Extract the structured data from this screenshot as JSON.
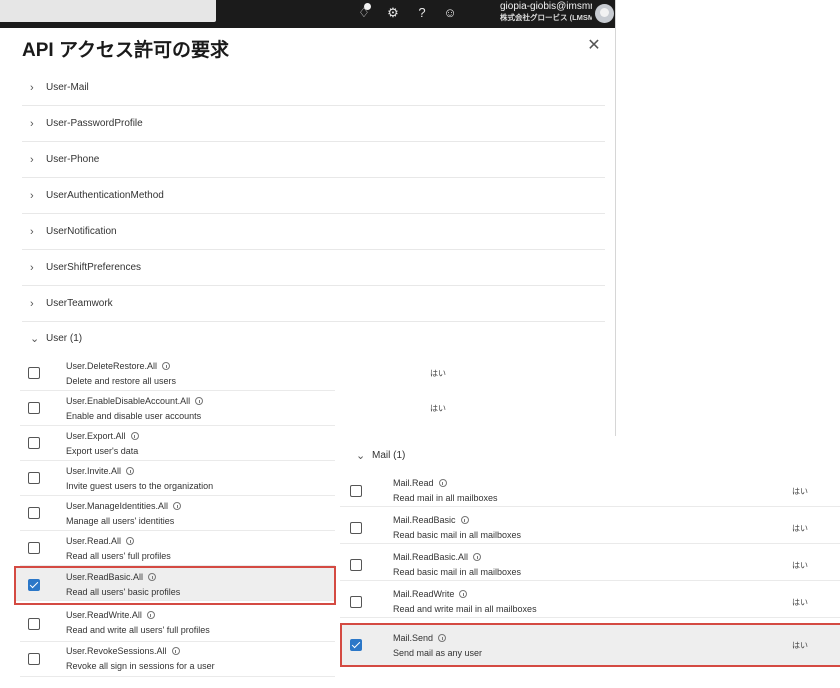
{
  "header": {
    "account_name": "giopia-giobis@imsmm…",
    "account_org": "株式会社グロービス (LMSMMS…"
  },
  "panel": {
    "title": "API アクセス許可の要求",
    "close_icon": "close-icon"
  },
  "groups": [
    {
      "label": "User-Mail"
    },
    {
      "label": "User-PasswordProfile"
    },
    {
      "label": "User-Phone"
    },
    {
      "label": "UserAuthenticationMethod"
    },
    {
      "label": "UserNotification"
    },
    {
      "label": "UserShiftPreferences"
    },
    {
      "label": "UserTeamwork"
    },
    {
      "label": "User (1)"
    }
  ],
  "user_permissions": [
    {
      "name": "User.DeleteRestore.All",
      "desc": "Delete and restore all users",
      "admin": "はい",
      "checked": false
    },
    {
      "name": "User.EnableDisableAccount.All",
      "desc": "Enable and disable user accounts",
      "admin": "はい",
      "checked": false
    },
    {
      "name": "User.Export.All",
      "desc": "Export user's data",
      "admin": "",
      "checked": false
    },
    {
      "name": "User.Invite.All",
      "desc": "Invite guest users to the organization",
      "admin": "",
      "checked": false
    },
    {
      "name": "User.ManageIdentities.All",
      "desc": "Manage all users' identities",
      "admin": "",
      "checked": false
    },
    {
      "name": "User.Read.All",
      "desc": "Read all users' full profiles",
      "admin": "",
      "checked": false
    },
    {
      "name": "User.ReadBasic.All",
      "desc": "Read all users' basic profiles",
      "admin": "",
      "checked": true
    },
    {
      "name": "User.ReadWrite.All",
      "desc": "Read and write all users' full profiles",
      "admin": "",
      "checked": false
    },
    {
      "name": "User.RevokeSessions.All",
      "desc": "Revoke all sign in sessions for a user",
      "admin": "",
      "checked": false
    }
  ],
  "mail_group": {
    "label": "Mail (1)"
  },
  "mail_permissions": [
    {
      "name": "Mail.Read",
      "desc": "Read mail in all mailboxes",
      "admin": "はい",
      "checked": false
    },
    {
      "name": "Mail.ReadBasic",
      "desc": "Read basic mail in all mailboxes",
      "admin": "はい",
      "checked": false
    },
    {
      "name": "Mail.ReadBasic.All",
      "desc": "Read basic mail in all mailboxes",
      "admin": "はい",
      "checked": false
    },
    {
      "name": "Mail.ReadWrite",
      "desc": "Read and write mail in all mailboxes",
      "admin": "はい",
      "checked": false
    },
    {
      "name": "Mail.Send",
      "desc": "Send mail as any user",
      "admin": "はい",
      "checked": true
    }
  ],
  "colors": {
    "highlight_border": "#d44a42",
    "checkbox_checked": "#2b77c8",
    "topbar": "#1b1b1b"
  }
}
